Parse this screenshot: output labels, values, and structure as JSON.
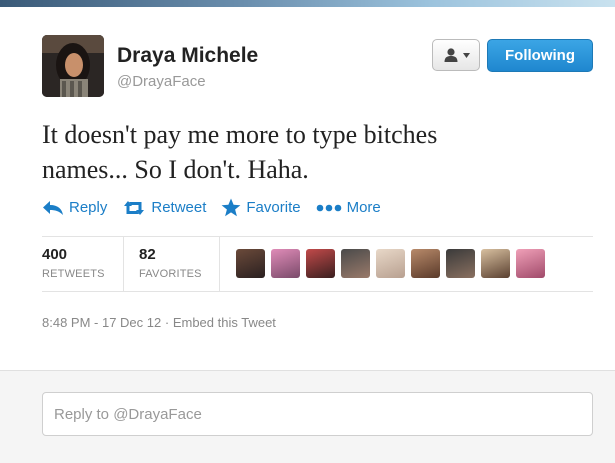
{
  "user": {
    "name": "Draya Michele",
    "handle": "@DrayaFace"
  },
  "header": {
    "follow_label": "Following",
    "user_menu_icon": "person-dropdown-icon"
  },
  "tweet": {
    "text_line1": "It doesn't pay me more to type bitches",
    "text_line2": "names... So I don't. Haha."
  },
  "actions": [
    {
      "label": "Reply",
      "icon": "reply-icon"
    },
    {
      "label": "Retweet",
      "icon": "retweet-icon"
    },
    {
      "label": "Favorite",
      "icon": "star-icon"
    },
    {
      "label": "More",
      "icon": "more-dots-icon"
    }
  ],
  "stats": {
    "retweets_count": "400",
    "retweets_label": "RETWEETS",
    "favorites_count": "82",
    "favorites_label": "FAVORITES"
  },
  "meta": {
    "timestamp": "8:48 PM - 17 Dec 12",
    "separator": "·",
    "embed_label": "Embed this Tweet"
  },
  "reply_box": {
    "placeholder": "Reply to @DrayaFace"
  },
  "colors": {
    "accent": "#1b7ec7",
    "button": "#2a91d8"
  }
}
